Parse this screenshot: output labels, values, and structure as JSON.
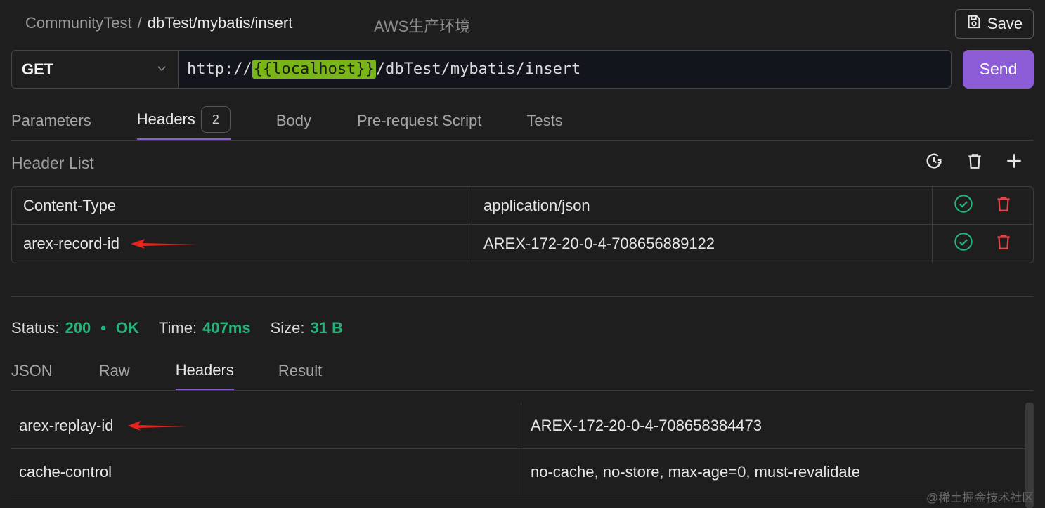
{
  "breadcrumb": {
    "workspace": "CommunityTest",
    "separator": "/",
    "request": "dbTest/mybatis/insert"
  },
  "environment": "AWS生产环境",
  "toolbar": {
    "save_label": "Save",
    "send_label": "Send"
  },
  "request": {
    "method": "GET",
    "url_prefix": "http://",
    "url_variable": "{{localhost}}",
    "url_suffix": "/dbTest/mybatis/insert"
  },
  "request_tabs": [
    {
      "label": "Parameters"
    },
    {
      "label": "Headers",
      "badge": "2"
    },
    {
      "label": "Body"
    },
    {
      "label": "Pre-request Script"
    },
    {
      "label": "Tests"
    }
  ],
  "header_list": {
    "title": "Header List",
    "rows": [
      {
        "key": "Content-Type",
        "value": "application/json"
      },
      {
        "key": "arex-record-id",
        "value": "AREX-172-20-0-4-708656889122"
      }
    ]
  },
  "response": {
    "status_label": "Status:",
    "status_code": "200",
    "status_dot": "•",
    "status_text": "OK",
    "time_label": "Time:",
    "time_value": "407ms",
    "size_label": "Size:",
    "size_value": "31 B",
    "tabs": [
      {
        "label": "JSON"
      },
      {
        "label": "Raw"
      },
      {
        "label": "Headers"
      },
      {
        "label": "Result"
      }
    ],
    "headers": [
      {
        "key": "arex-replay-id",
        "value": "AREX-172-20-0-4-708658384473"
      },
      {
        "key": "cache-control",
        "value": "no-cache, no-store, max-age=0, must-revalidate"
      }
    ]
  },
  "watermark": "@稀土掘金技术社区",
  "colors": {
    "accent": "#8c5bd6",
    "success": "#25b37a",
    "danger": "#e5484d",
    "variable": "#7ab518",
    "arrow": "#e8231b"
  }
}
